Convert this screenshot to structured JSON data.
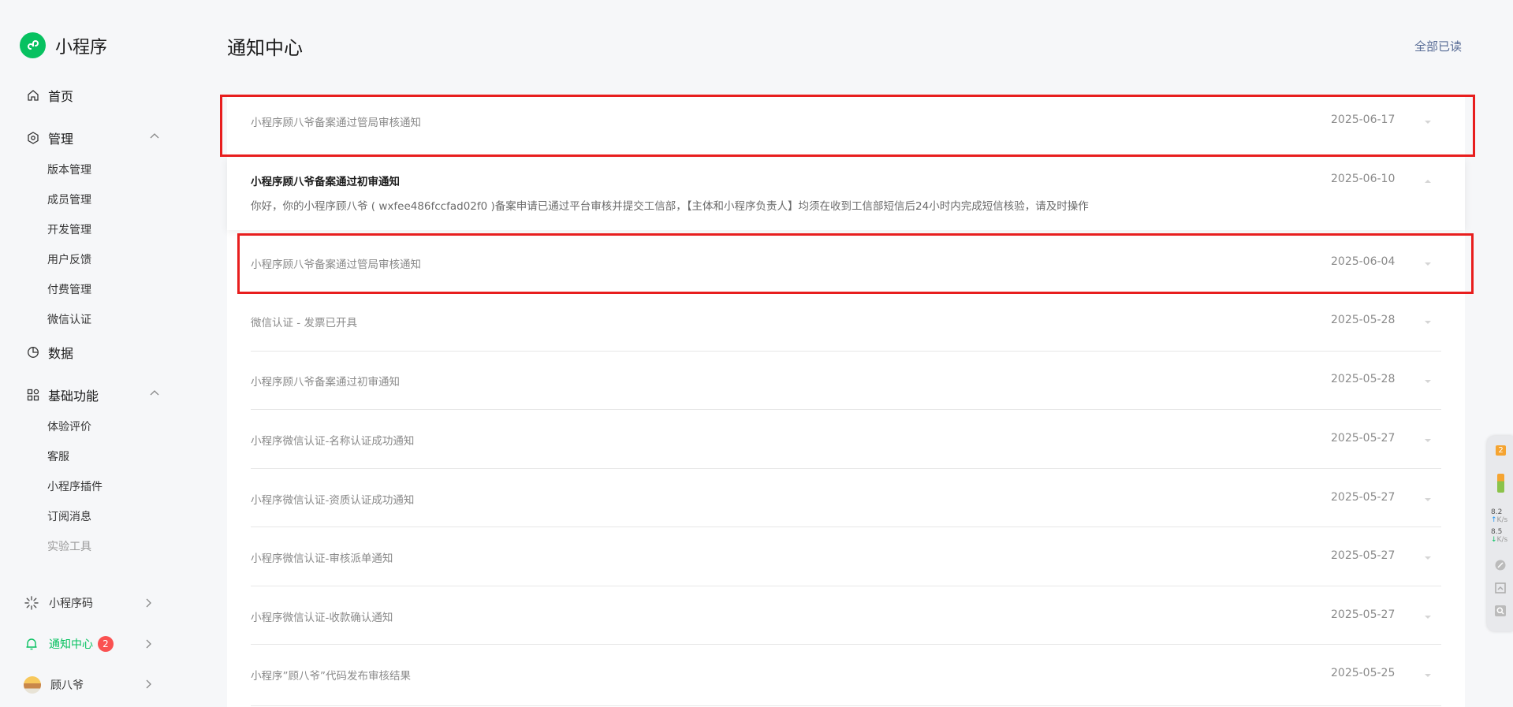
{
  "app": {
    "name": "小程序",
    "brand_color": "#07c160"
  },
  "sidebar": {
    "home": "首页",
    "manage": {
      "label": "管理",
      "items": [
        "版本管理",
        "成员管理",
        "开发管理",
        "用户反馈",
        "付费管理",
        "微信认证"
      ]
    },
    "data": "数据",
    "basic": {
      "label": "基础功能",
      "items": [
        "体验评价",
        "客服",
        "小程序插件",
        "订阅消息"
      ],
      "disabled_item": "实验工具"
    },
    "bottom": {
      "qrcode": "小程序码",
      "notify": {
        "label": "通知中心",
        "badge": "2"
      },
      "account": "顾八爷"
    }
  },
  "header": {
    "title": "通知中心",
    "mark_all_read": "全部已读"
  },
  "notifications": [
    {
      "title": "小程序顾八爷备案通过管局审核通知",
      "date": "2025-06-17",
      "highlighted": true
    },
    {
      "title": "小程序顾八爷备案通过初审通知",
      "date": "2025-06-10",
      "expanded": true,
      "desc": "你好，你的小程序顾八爷 ( wxfee486fccfad02f0 )备案申请已通过平台审核并提交工信部，【主体和小程序负责人】均须在收到工信部短信后24小时内完成短信核验，请及时操作"
    },
    {
      "title": "小程序顾八爷备案通过管局审核通知",
      "date": "2025-06-04",
      "highlighted": true
    },
    {
      "title": "微信认证 - 发票已开具",
      "date": "2025-05-28"
    },
    {
      "title": "小程序顾八爷备案通过初审通知",
      "date": "2025-05-28"
    },
    {
      "title": "小程序微信认证-名称认证成功通知",
      "date": "2025-05-27"
    },
    {
      "title": "小程序微信认证-资质认证成功通知",
      "date": "2025-05-27"
    },
    {
      "title": "小程序微信认证-审核派单通知",
      "date": "2025-05-27"
    },
    {
      "title": "小程序微信认证-收款确认通知",
      "date": "2025-05-27"
    },
    {
      "title": "小程序”顾八爷”代码发布审核结果",
      "date": "2025-05-25"
    }
  ],
  "tool_panel": {
    "badge": "2",
    "upload": "8.2",
    "download": "8.5",
    "unit": "K/s"
  }
}
